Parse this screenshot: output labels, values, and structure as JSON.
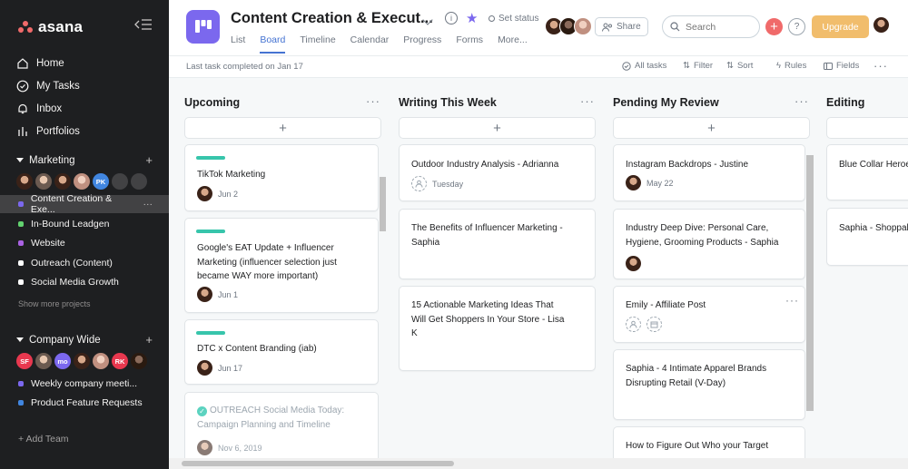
{
  "sidebar": {
    "logo": "asana",
    "nav": [
      "Home",
      "My Tasks",
      "Inbox",
      "Portfolios"
    ],
    "marketing": {
      "title": "Marketing",
      "avatar_initials": "PK",
      "projects": [
        {
          "name": "Content Creation & Exe...",
          "color": "#7b68ee",
          "active": true
        },
        {
          "name": "In-Bound Leadgen",
          "color": "#62d26f"
        },
        {
          "name": "Website",
          "color": "#aa62e3"
        },
        {
          "name": "Outreach (Content)",
          "color": "#ffffff"
        },
        {
          "name": "Social Media Growth",
          "color": "#ffffff"
        }
      ],
      "show_more": "Show more projects"
    },
    "company": {
      "title": "Company Wide",
      "avatars": [
        "SF",
        "mo",
        "RK"
      ],
      "projects": [
        {
          "name": "Weekly company meeti...",
          "color": "#7b68ee"
        },
        {
          "name": "Product Feature Requests",
          "color": "#4186e0"
        }
      ]
    },
    "add_team": "+ Add Team"
  },
  "header": {
    "title": "Content Creation & Execut...",
    "set_status": "Set status",
    "tabs": [
      "List",
      "Board",
      "Timeline",
      "Calendar",
      "Progress",
      "Forms",
      "More..."
    ],
    "active_tab": "Board",
    "share": "Share",
    "search_placeholder": "Search",
    "upgrade": "Upgrade"
  },
  "subheader": {
    "last_task": "Last task completed on Jan 17",
    "all_tasks": "All tasks",
    "filter": "Filter",
    "sort": "Sort",
    "rules": "Rules",
    "fields": "Fields"
  },
  "board": {
    "columns": [
      {
        "title": "Upcoming",
        "cards": [
          {
            "title": "TikTok Marketing",
            "date": "Jun 2"
          },
          {
            "title_lines": [
              "Google's EAT Update + Influencer",
              "Marketing (influencer selection just",
              "became WAY more important)"
            ],
            "date": "Jun 1"
          },
          {
            "title": "DTC x Content Branding (iab)",
            "date": "Jun 17"
          },
          {
            "title_lines": [
              "OUTREACH Social Media Today:",
              "Campaign Planning and Timeline"
            ],
            "date": "Nov 6, 2019"
          }
        ]
      },
      {
        "title": "Writing This Week",
        "cards": [
          {
            "title": "Outdoor Industry Analysis - Adrianna",
            "date": "Tuesday"
          },
          {
            "title_lines": [
              "The Benefits of Influencer Marketing -",
              "Saphia"
            ]
          },
          {
            "title_lines": [
              "15 Actionable Marketing Ideas That",
              "Will Get Shoppers In Your Store - Lisa",
              "K"
            ]
          }
        ]
      },
      {
        "title": "Pending My Review",
        "cards": [
          {
            "title": "Instagram Backdrops - Justine",
            "date": "May 22"
          },
          {
            "title_lines": [
              "Industry Deep Dive: Personal Care,",
              "Hygiene, Grooming Products - Saphia"
            ]
          },
          {
            "title": "Emily - Affiliate Post"
          },
          {
            "title_lines": [
              "Saphia - 4 Intimate Apparel Brands",
              "Disrupting Retail (V-Day)"
            ]
          },
          {
            "title": "How to Figure Out Who your Target"
          }
        ]
      },
      {
        "title": "Editing",
        "cards": [
          {
            "title": "Blue Collar Heroes"
          },
          {
            "title": "Saphia - Shoppab"
          }
        ]
      }
    ]
  }
}
